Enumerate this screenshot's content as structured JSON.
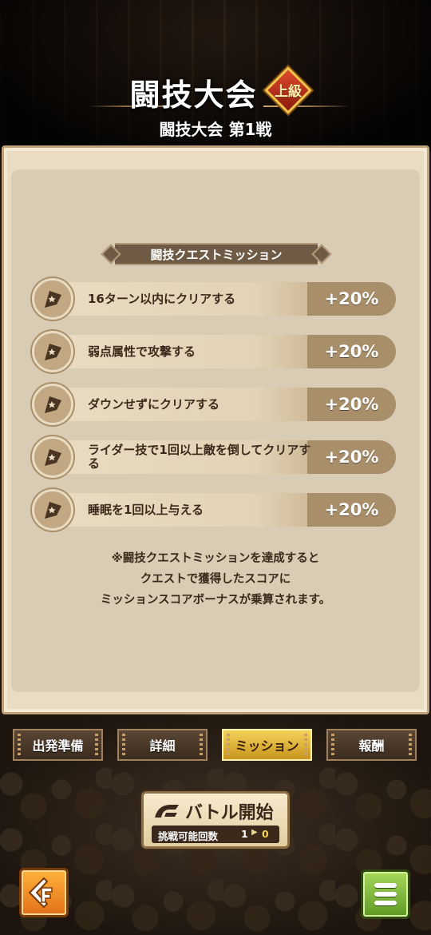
{
  "header": {
    "title": "闘技大会",
    "rank_badge": "上級",
    "subtitle": "闘技大会 第1戦"
  },
  "section_title": "闘技クエストミッション",
  "missions": [
    {
      "label": "16ターン以内にクリアする",
      "bonus": "+20%"
    },
    {
      "label": "弱点属性で攻撃する",
      "bonus": "+20%"
    },
    {
      "label": "ダウンせずにクリアする",
      "bonus": "+20%"
    },
    {
      "label": "ライダー技で1回以上敵を倒してクリアする",
      "bonus": "+20%"
    },
    {
      "label": "睡眠を1回以上与える",
      "bonus": "+20%"
    }
  ],
  "note_lines": [
    "※闘技クエストミッションを達成すると",
    "クエストで獲得したスコアに",
    "ミッションスコアボーナスが乗算されます。"
  ],
  "tabs": [
    {
      "label": "出発準備",
      "active": false
    },
    {
      "label": "詳細",
      "active": false
    },
    {
      "label": "ミッション",
      "active": true
    },
    {
      "label": "報酬",
      "active": false
    }
  ],
  "battle": {
    "label": "バトル開始",
    "tries_label": "挑戦可能回数",
    "tries_from": "1",
    "tries_to": "0"
  },
  "icons": {
    "mission": "flag-icon",
    "back": "back-arrow-icon",
    "menu": "hamburger-menu-icon"
  },
  "colors": {
    "active_tab": "#f4d35a",
    "panel": "#e9dcc2",
    "bonus_bg": "#a88f6a",
    "back_button": "#ffb23a",
    "menu_button": "#a6d85a"
  }
}
